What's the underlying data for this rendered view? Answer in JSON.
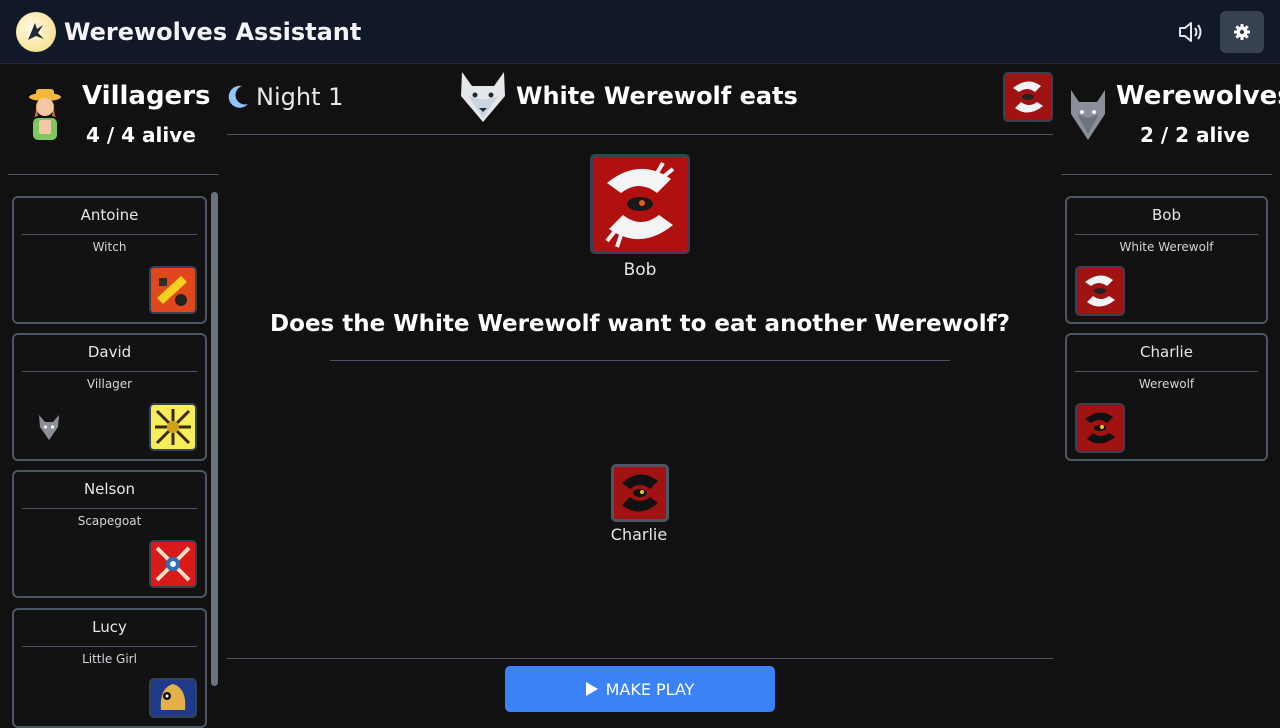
{
  "app": {
    "title": "Werewolves Assistant"
  },
  "header": {
    "sound_icon": "volume-icon",
    "settings_icon": "gear-icon"
  },
  "villagers": {
    "title": "Villagers",
    "alive": "4 / 4 alive",
    "players": [
      {
        "name": "Antoine",
        "role": "Witch"
      },
      {
        "name": "David",
        "role": "Villager"
      },
      {
        "name": "Nelson",
        "role": "Scapegoat"
      },
      {
        "name": "Lucy",
        "role": "Little Girl"
      }
    ]
  },
  "werewolves": {
    "title": "Werewolves",
    "alive": "2 / 2 alive",
    "players": [
      {
        "name": "Bob",
        "role": "White Werewolf"
      },
      {
        "name": "Charlie",
        "role": "Werewolf"
      }
    ]
  },
  "phase": {
    "night_label": "Night 1",
    "title": "White Werewolf eats"
  },
  "play": {
    "actor_name": "Bob",
    "question": "Does the White Werewolf want to eat another Werewolf?",
    "target_name": "Charlie",
    "make_play_label": "MAKE PLAY"
  },
  "colors": {
    "accent": "#3b82f6",
    "topbar": "#111827",
    "background": "#111111",
    "card_border": "#4b5563",
    "role_red": "#8b0000"
  }
}
